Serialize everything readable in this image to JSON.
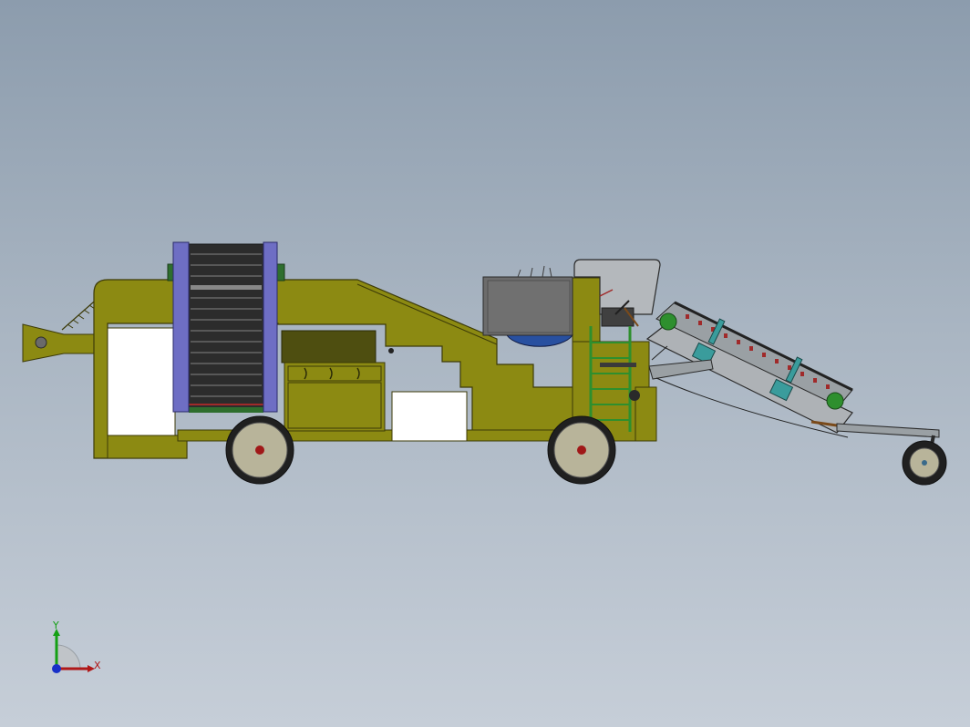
{
  "triad": {
    "x_label": "X",
    "y_label": "Y",
    "colors": {
      "x": "#b01818",
      "y": "#14a014",
      "z": "#1830c8"
    }
  },
  "palette": {
    "body": "#8c8a12",
    "body_edge": "#3c3a08",
    "ladder": "#2e8f2e",
    "belt": "#2c2c2c",
    "belt_frame": "#6e6ec4",
    "conveyor": "#aeb2b6",
    "tooth": "#a02a2a",
    "tire": "#202020",
    "hub": "#b8b49a",
    "axle": "#a01818",
    "tank_blue": "#2850a0",
    "teal": "#3a9c9c"
  }
}
